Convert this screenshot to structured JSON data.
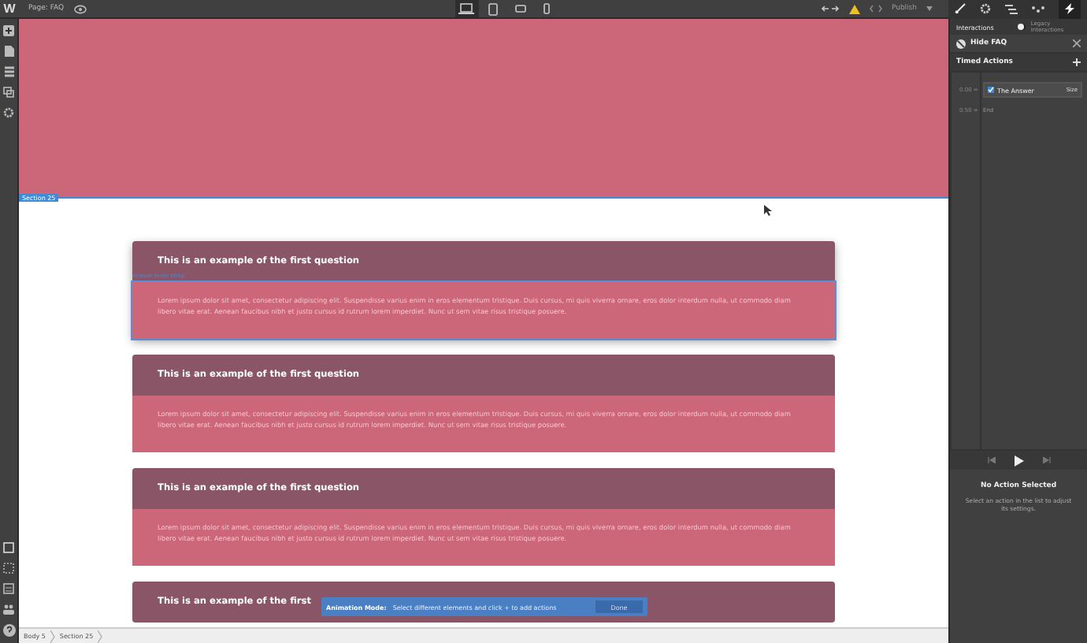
{
  "topbar": {
    "logo": "W",
    "page_label": "Page: FAQ",
    "devices": [
      {
        "kind": "desktop",
        "selected": true
      },
      {
        "kind": "tablet",
        "selected": false
      },
      {
        "kind": "landscape",
        "selected": false
      },
      {
        "kind": "phone",
        "selected": false
      }
    ],
    "publish": {
      "label": "Publish",
      "disabled": true
    }
  },
  "canvas": {
    "section_label": "Section 25",
    "selected_label": "Answer Inner Wrap",
    "cards": [
      {
        "question": "This is an example of the first question",
        "answer": "Lorem ipsum dolor sit amet, consectetur adipiscing elit. Suspendisse varius enim in eros elementum tristique. Duis cursus, mi quis viverra ornare, eros dolor interdum nulla, ut commodo diam libero vitae erat. Aenean faucibus nibh et justo cursus id rutrum lorem imperdiet. Nunc ut sem vitae risus tristique posuere.",
        "selected": true
      },
      {
        "question": "This is an example of the first question",
        "answer": "Lorem ipsum dolor sit amet, consectetur adipiscing elit. Suspendisse varius enim in eros elementum tristique. Duis cursus, mi quis viverra ornare, eros dolor interdum nulla, ut commodo diam libero vitae erat. Aenean faucibus nibh et justo cursus id rutrum lorem imperdiet. Nunc ut sem vitae risus tristique posuere.",
        "selected": false
      },
      {
        "question": "This is an example of the first question",
        "answer": "Lorem ipsum dolor sit amet, consectetur adipiscing elit. Suspendisse varius enim in eros elementum tristique. Duis cursus, mi quis viverra ornare, eros dolor interdum nulla, ut commodo diam libero vitae erat. Aenean faucibus nibh et justo cursus id rutrum lorem imperdiet. Nunc ut sem vitae risus tristique posuere.",
        "selected": false
      },
      {
        "question": "This is an example of the first",
        "selected": false
      }
    ],
    "toast": {
      "title": "Animation Mode:",
      "message": "Select different elements and click + to add actions",
      "button": "Done"
    }
  },
  "breadcrumbs": [
    "Body 5",
    "Section 25"
  ],
  "panel": {
    "tab": "Interactions",
    "legacy": {
      "label": "Legacy Interactions",
      "on": false
    },
    "interaction": "Hide FAQ",
    "timed_title": "Timed Actions",
    "actions": [
      {
        "time": "0.00 =",
        "kind": "action",
        "label": "The Answer",
        "checked": true,
        "tag": "Size"
      },
      {
        "time": "0.50 =",
        "kind": "end",
        "label": "End"
      }
    ],
    "empty_title": "No Action Selected",
    "empty_text": "Select an action in the list to adjust its settings."
  }
}
